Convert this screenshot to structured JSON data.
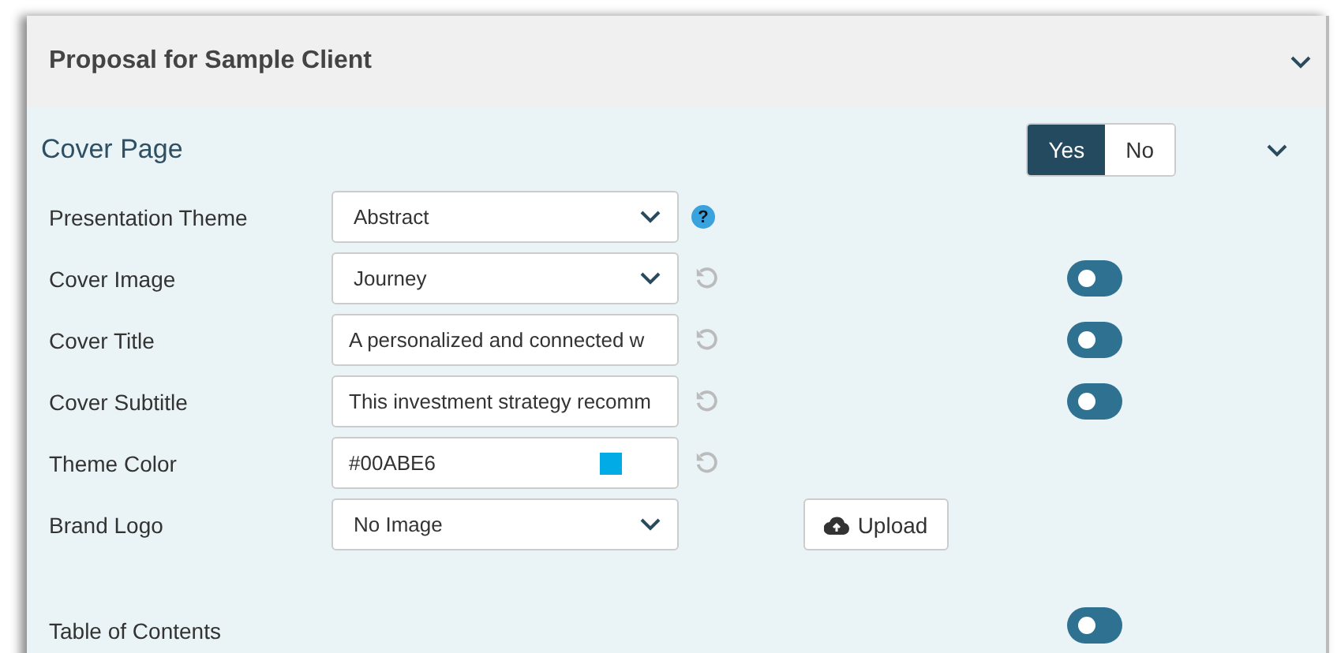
{
  "panel": {
    "title": "Proposal for Sample Client"
  },
  "section": {
    "title": "Cover Page",
    "choices": [
      {
        "label": "Yes",
        "selected": true
      },
      {
        "label": "No",
        "selected": false
      }
    ]
  },
  "rows": [
    {
      "label": "Presentation Theme",
      "kind": "select",
      "value": "Abstract",
      "accessory": {
        "kind": "help",
        "text": "?"
      }
    },
    {
      "label": "Cover Image",
      "kind": "select",
      "value": "Journey",
      "accessory": {
        "kind": "reset"
      },
      "toggle": {
        "on": false
      }
    },
    {
      "label": "Cover Title",
      "kind": "text",
      "value": "A personalized and connected w",
      "accessory": {
        "kind": "reset"
      },
      "toggle": {
        "on": false
      }
    },
    {
      "label": "Cover Subtitle",
      "kind": "text",
      "value": "This investment strategy recomm",
      "accessory": {
        "kind": "reset"
      },
      "toggle": {
        "on": false
      }
    },
    {
      "label": "Theme Color",
      "kind": "color",
      "value": "#00ABE6",
      "color": "#00abe6",
      "accessory": {
        "kind": "reset"
      }
    },
    {
      "label": "Brand Logo",
      "kind": "select",
      "value": "No Image",
      "accessory": {
        "kind": "upload",
        "text": "Upload"
      }
    },
    {
      "label": "Table of Contents",
      "kind": "heading",
      "toggle": {
        "on": false
      }
    }
  ]
}
